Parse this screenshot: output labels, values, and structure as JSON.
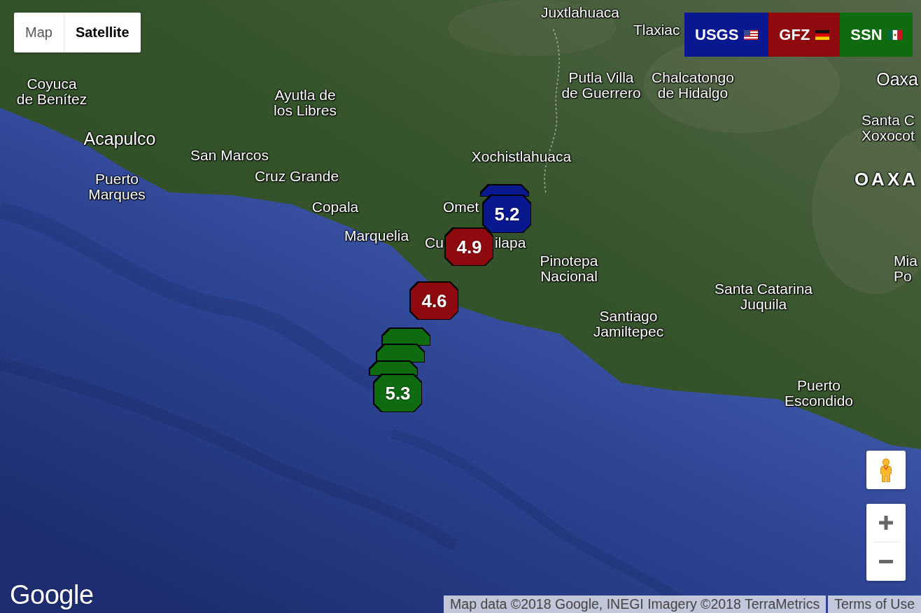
{
  "map_type": [
    {
      "label": "Map",
      "selected": false
    },
    {
      "label": "Satellite",
      "selected": true
    }
  ],
  "agencies": [
    {
      "label": "USGS",
      "color": "#0a1890"
    },
    {
      "label": "GFZ",
      "color": "#8e0a0e"
    },
    {
      "label": "SSN",
      "color": "#0e6b10"
    }
  ],
  "places": [
    {
      "name": "Juxtlahuaca",
      "kind": "town"
    },
    {
      "name": "Tlaxiac",
      "kind": "town"
    },
    {
      "name": "Coyuca\nde Benítez",
      "kind": "town"
    },
    {
      "name": "Ayutla de\nlos Libres",
      "kind": "town"
    },
    {
      "name": "Putla Villa\nde Guerrero",
      "kind": "town"
    },
    {
      "name": "Chalcatongo\nde Hidalgo",
      "kind": "town"
    },
    {
      "name": "Oaxa",
      "kind": "city"
    },
    {
      "name": "Acapulco",
      "kind": "city"
    },
    {
      "name": "Santa C\nXoxocot",
      "kind": "town"
    },
    {
      "name": "San Marcos",
      "kind": "town"
    },
    {
      "name": "Xochistlahuaca",
      "kind": "town"
    },
    {
      "name": "Puerto\nMarques",
      "kind": "town"
    },
    {
      "name": "Cruz Grande",
      "kind": "town"
    },
    {
      "name": "OAXA",
      "kind": "region"
    },
    {
      "name": "Copala",
      "kind": "town"
    },
    {
      "name": "Omet",
      "kind": "town"
    },
    {
      "name": "Marquelia",
      "kind": "town"
    },
    {
      "name": "Cu",
      "kind": "town"
    },
    {
      "name": "ilapa",
      "kind": "town"
    },
    {
      "name": "Pinotepa\nNacional",
      "kind": "town"
    },
    {
      "name": "Santa Catarina\nJuquila",
      "kind": "town"
    },
    {
      "name": "Mia\nPo",
      "kind": "town"
    },
    {
      "name": "Santiago\nJamiltepec",
      "kind": "town"
    },
    {
      "name": "Puerto\nEscondido",
      "kind": "town"
    }
  ],
  "markers": [
    {
      "color": "#0a1890"
    },
    {
      "magnitude": "5.2",
      "color": "#0a1890"
    },
    {
      "magnitude": "4.9",
      "color": "#8e0a0e"
    },
    {
      "magnitude": "4.6",
      "color": "#8e0a0e"
    },
    {
      "color": "#0e6b10"
    },
    {
      "color": "#0e6b10"
    },
    {
      "color": "#0e6b10"
    },
    {
      "magnitude": "5.3",
      "color": "#0e6b10"
    }
  ],
  "logo": "Google",
  "attribution": {
    "text": "Map data ©2018 Google, INEGI Imagery ©2018 TerraMetrics",
    "terms": "Terms of Use"
  }
}
